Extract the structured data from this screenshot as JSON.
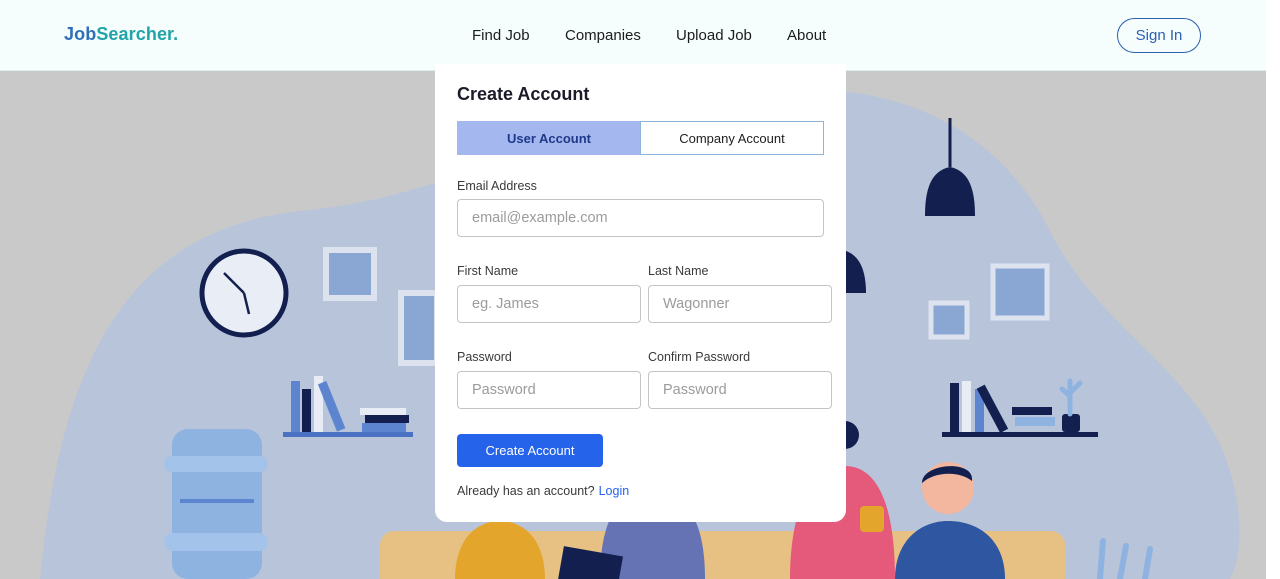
{
  "brand": {
    "name_part1": "Job",
    "name_part2": "Searcher."
  },
  "nav": {
    "items": [
      {
        "label": "Find Job"
      },
      {
        "label": "Companies"
      },
      {
        "label": "Upload Job"
      },
      {
        "label": "About"
      }
    ],
    "sign_in_label": "Sign In"
  },
  "form": {
    "title": "Create Account",
    "tabs": [
      {
        "label": "User Account",
        "active": true
      },
      {
        "label": "Company Account",
        "active": false
      }
    ],
    "email": {
      "label": "Email Address",
      "placeholder": "email@example.com",
      "value": ""
    },
    "first_name": {
      "label": "First Name",
      "placeholder": "eg. James",
      "value": ""
    },
    "last_name": {
      "label": "Last Name",
      "placeholder": "Wagonner",
      "value": ""
    },
    "password": {
      "label": "Password",
      "placeholder": "Password",
      "value": ""
    },
    "confirm_password": {
      "label": "Confirm Password",
      "placeholder": "Password",
      "value": ""
    },
    "submit_label": "Create Account",
    "footer_text": "Already has an account?",
    "login_link": "Login"
  },
  "colors": {
    "brand_blue": "#2f6fb8",
    "brand_teal": "#20a4a8",
    "primary_button": "#2563eb",
    "active_tab": "#a4b7ee",
    "backdrop": "#c9c9c9",
    "illustration_blob": "#b8c4da",
    "illustration_navy": "#13204f"
  }
}
